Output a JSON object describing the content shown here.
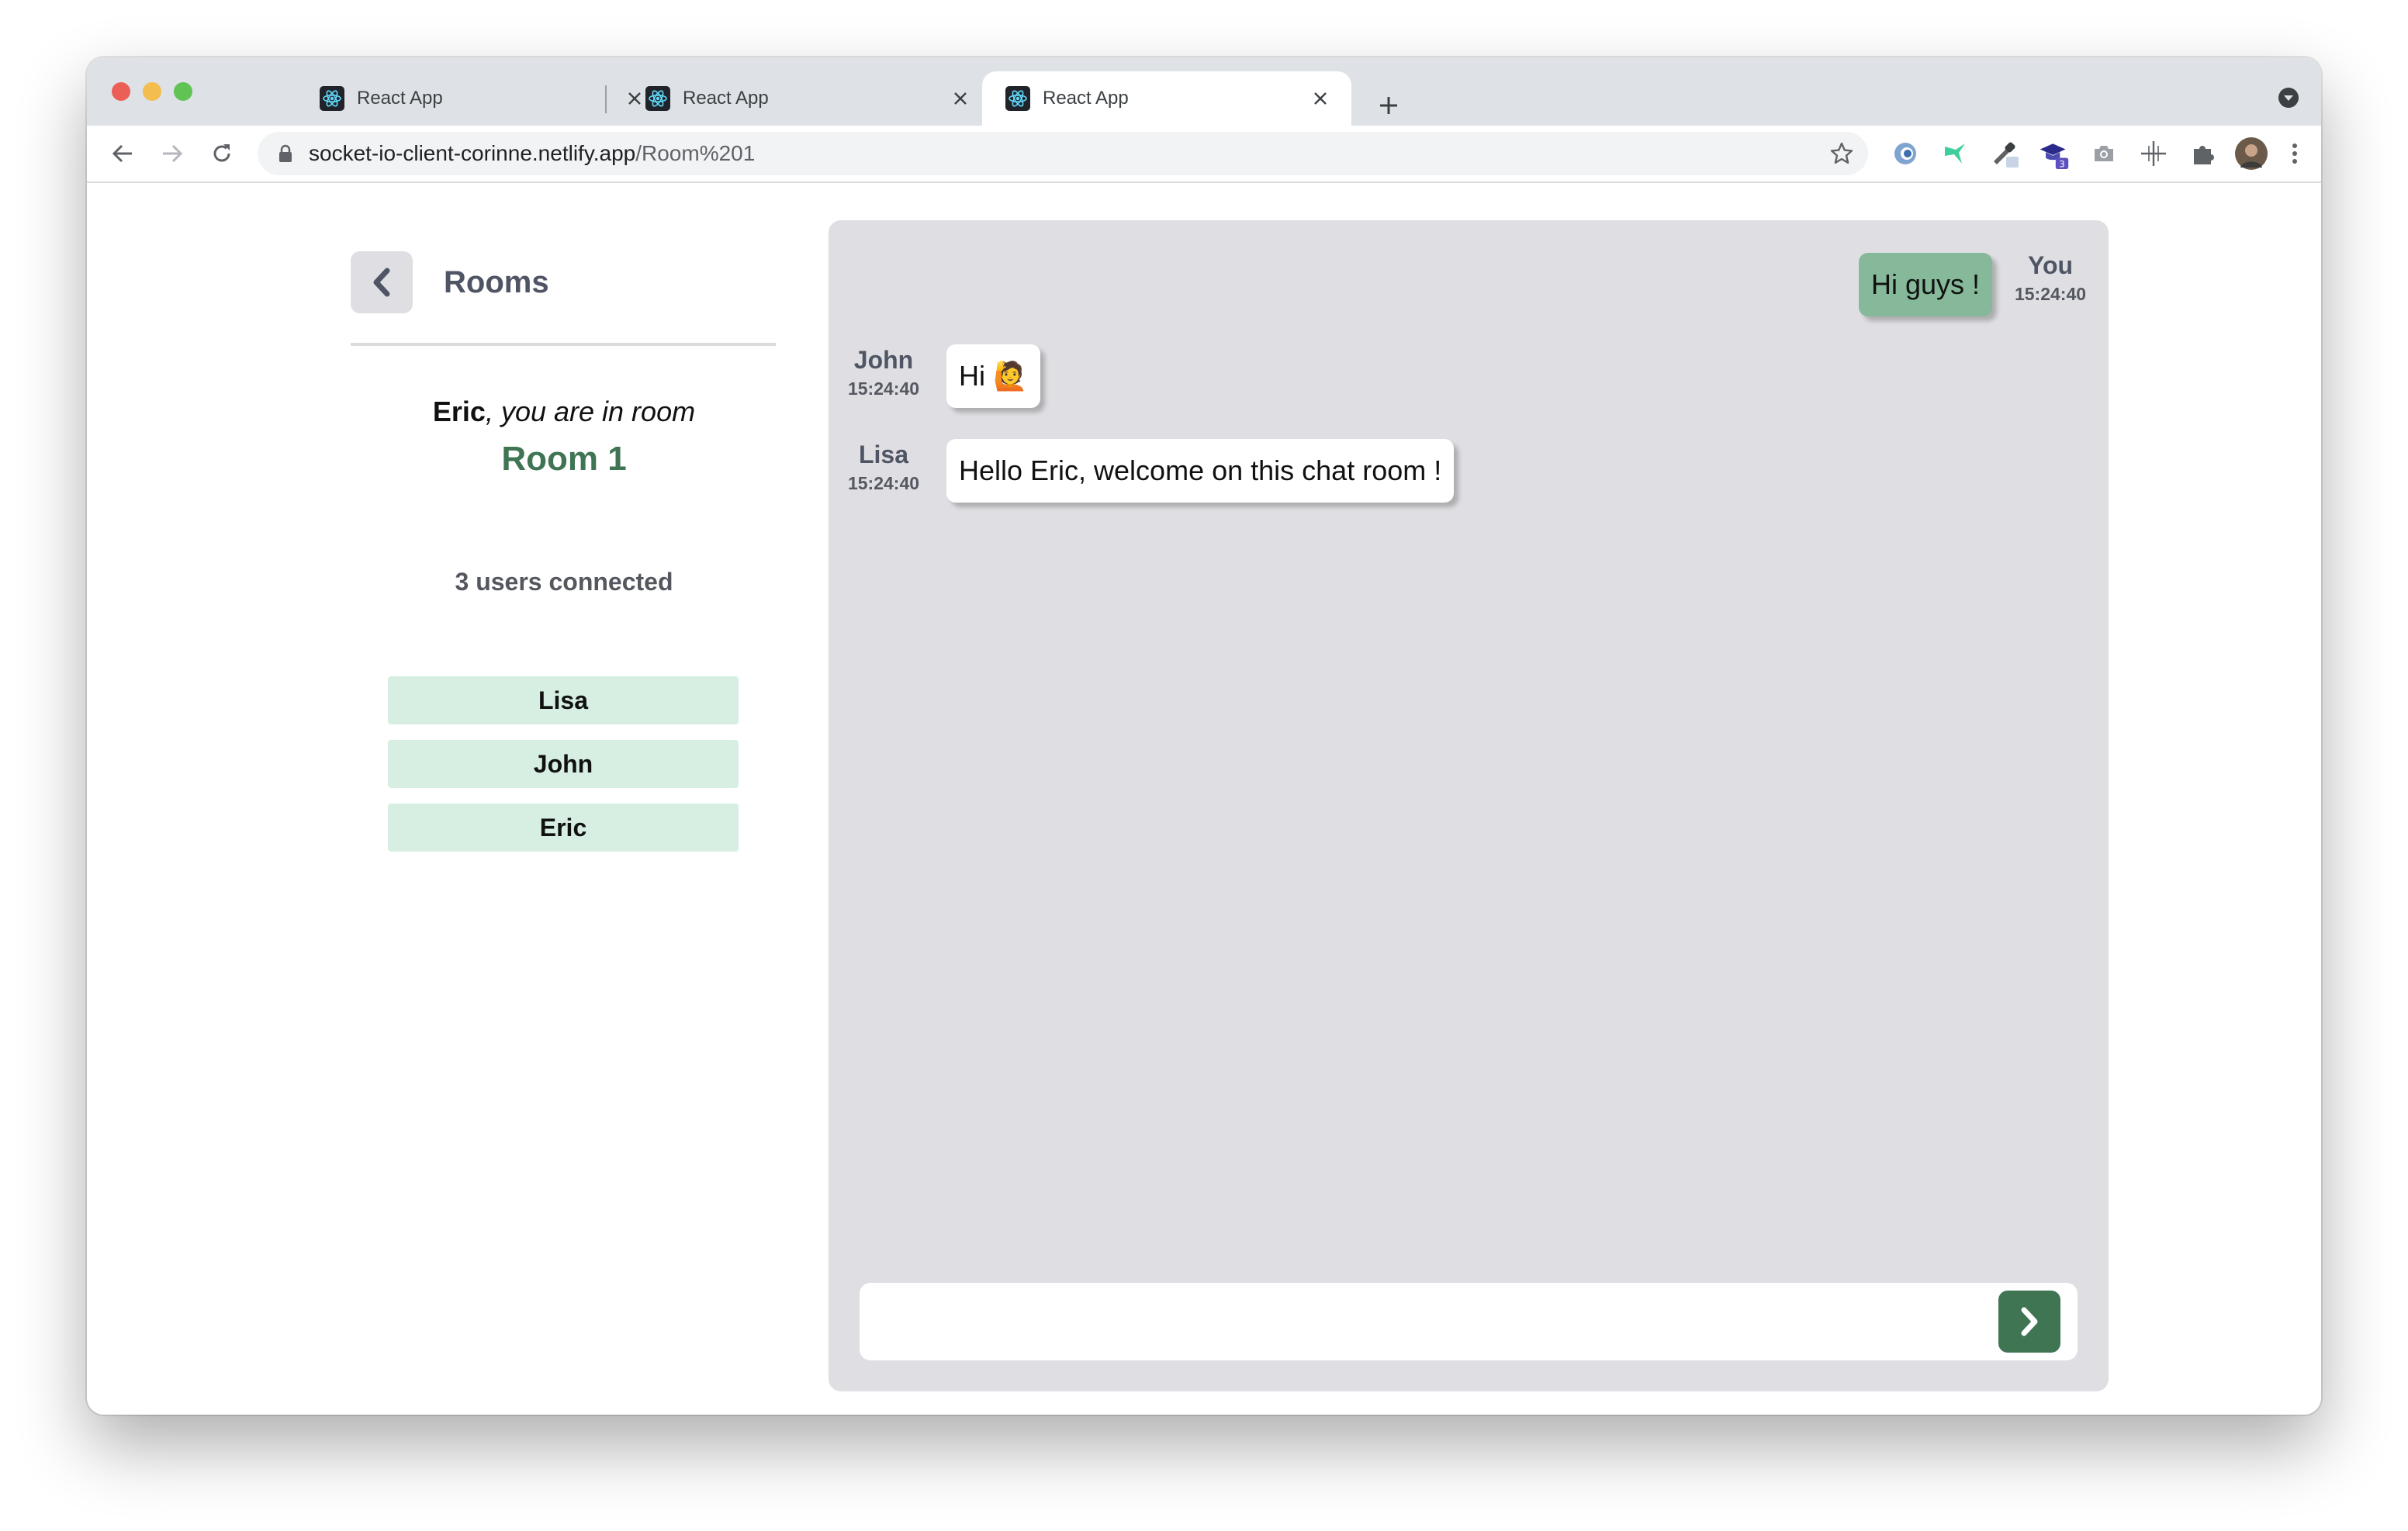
{
  "browser": {
    "tabs": [
      {
        "title": "React App",
        "active": false
      },
      {
        "title": "React App",
        "active": false
      },
      {
        "title": "React App",
        "active": true
      }
    ],
    "url_host": "socket-io-client-corinne.netlify.app",
    "url_path": "/Room%201",
    "extensions": [
      "edge-extension-icon",
      "hummingbird-icon",
      "eyedropper-icon",
      "graduation-cap-icon",
      "camera-icon",
      "crosshair-move-icon",
      "puzzle-icon",
      "profile-avatar"
    ],
    "extension_badge": "3"
  },
  "sidebar": {
    "back_icon": "chevron-left-icon",
    "rooms_label": "Rooms",
    "user_name": "Eric",
    "in_room_text": ", you are in room",
    "room_name": "Room 1",
    "users_connected": "3 users connected",
    "users": [
      "Lisa",
      "John",
      "Eric"
    ]
  },
  "chat": {
    "messages": [
      {
        "author": "You",
        "time": "15:24:40",
        "text": "Hi guys !",
        "mine": true
      },
      {
        "author": "John",
        "time": "15:24:40",
        "text": "Hi 🙋",
        "mine": false
      },
      {
        "author": "Lisa",
        "time": "15:24:40",
        "text": "Hello Eric, welcome on this chat room !",
        "mine": false
      }
    ],
    "input_value": "",
    "send_icon": "chevron-right-icon"
  },
  "colors": {
    "accent_green": "#3f7553",
    "my_bubble": "#86b89a",
    "user_pill": "#d6efe2",
    "chat_bg": "#dfdfe3"
  }
}
